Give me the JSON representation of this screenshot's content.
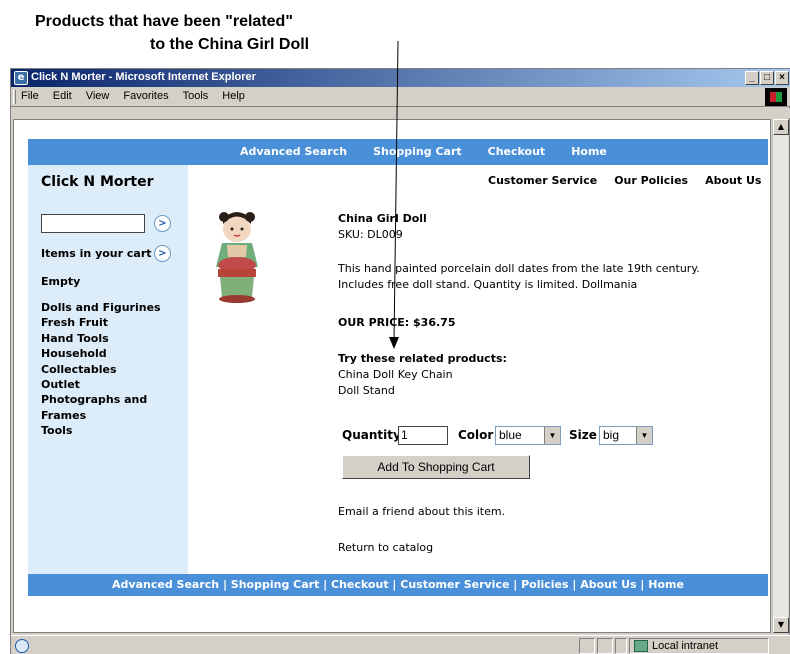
{
  "annotation": {
    "line1": "Products that have been \"related\"",
    "line2": "to the China Girl Doll"
  },
  "window": {
    "title": "Click N Morter - Microsoft Internet Explorer",
    "controls": {
      "minimize": "_",
      "maximize": "□",
      "close": "×"
    }
  },
  "menubar": {
    "items": [
      "File",
      "Edit",
      "View",
      "Favorites",
      "Tools",
      "Help"
    ]
  },
  "topnav": {
    "items": [
      "Advanced Search",
      "Shopping Cart",
      "Checkout",
      "Home"
    ]
  },
  "sidebar": {
    "brand": "Click N Morter",
    "search_value": "",
    "go_label": ">",
    "cart_label": "Items in your cart",
    "cart_status": "Empty",
    "categories": [
      "Dolls and Figurines",
      "Fresh Fruit",
      "Hand Tools",
      "Household",
      "Collectables",
      "Outlet",
      "Photographs and",
      "Frames",
      "Tools"
    ]
  },
  "subnav": {
    "items": [
      "Customer Service",
      "Our Policies",
      "About Us"
    ]
  },
  "product": {
    "name": "China Girl Doll",
    "sku": "SKU: DL009",
    "description_line1": "This hand painted porcelain doll dates from the late 19th century.",
    "description_line2": "Includes free doll stand. Quantity is limited. Dollmania",
    "price": "OUR PRICE: $36.75",
    "related_heading": "Try these related products:",
    "related": [
      "China Doll Key Chain",
      "Doll Stand"
    ],
    "quantity_label": "Quantity",
    "quantity_value": "1",
    "color_label": "Color",
    "color_value": "blue",
    "size_label": "Size",
    "size_value": "big",
    "add_button": "Add To Shopping Cart",
    "email_link": "Email a friend about this item.",
    "return_link": "Return to catalog"
  },
  "footer": {
    "nav": "Advanced Search | Shopping Cart | Checkout | Customer Service | Policies | About Us | Home"
  },
  "statusbar": {
    "zone": "Local intranet"
  },
  "colors": {
    "nav_blue": "#4a90d9",
    "sidebar_bg": "#dcecf9",
    "title_gradient_start": "#0a246a"
  }
}
